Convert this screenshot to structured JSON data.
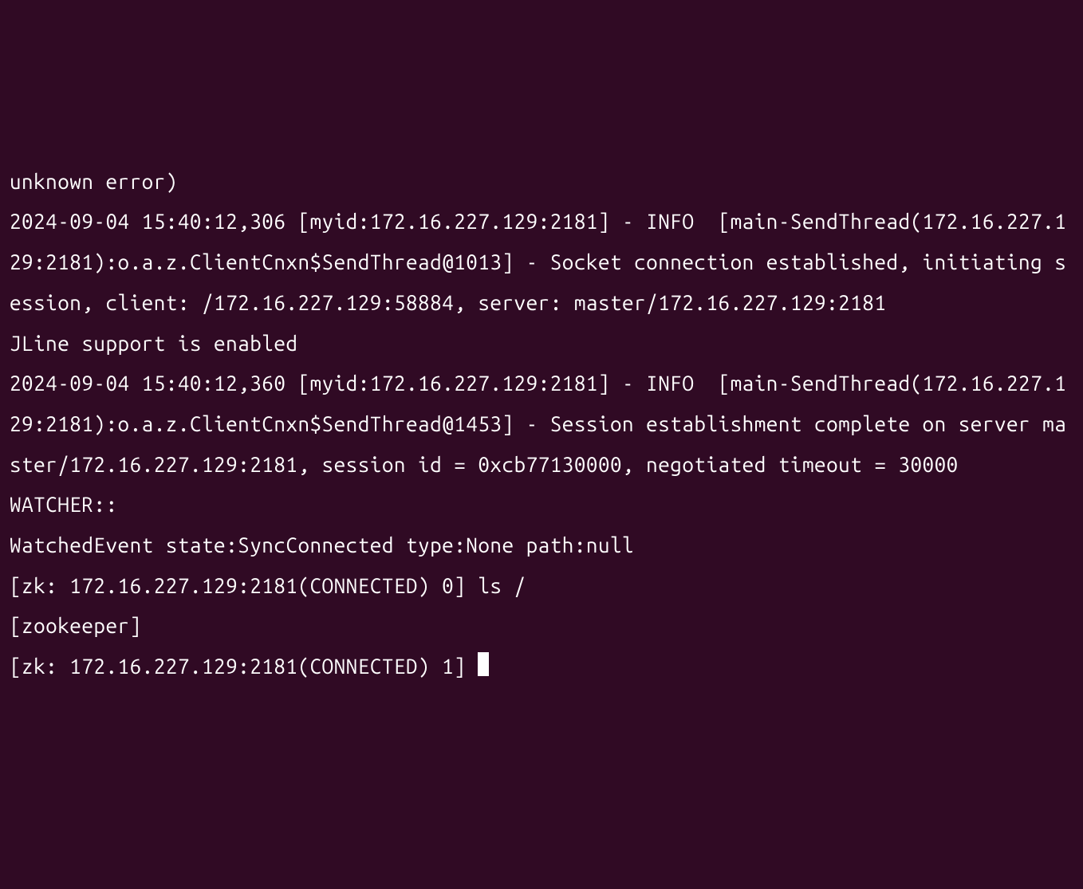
{
  "terminal": {
    "lines": [
      "unknown error)",
      "2024-09-04 15:40:12,306 [myid:172.16.227.129:2181] - INFO  [main-SendThread(172.16.227.129:2181):o.a.z.ClientCnxn$SendThread@1013] - Socket connection established, initiating session, client: /172.16.227.129:58884, server: master/172.16.227.129:2181",
      "JLine support is enabled",
      "2024-09-04 15:40:12,360 [myid:172.16.227.129:2181] - INFO  [main-SendThread(172.16.227.129:2181):o.a.z.ClientCnxn$SendThread@1453] - Session establishment complete on server master/172.16.227.129:2181, session id = 0xcb77130000, negotiated timeout = 30000",
      "",
      "WATCHER::",
      "",
      "WatchedEvent state:SyncConnected type:None path:null",
      "[zk: 172.16.227.129:2181(CONNECTED) 0] ls /",
      "[zookeeper]"
    ],
    "current_prompt": "[zk: 172.16.227.129:2181(CONNECTED) 1] "
  }
}
